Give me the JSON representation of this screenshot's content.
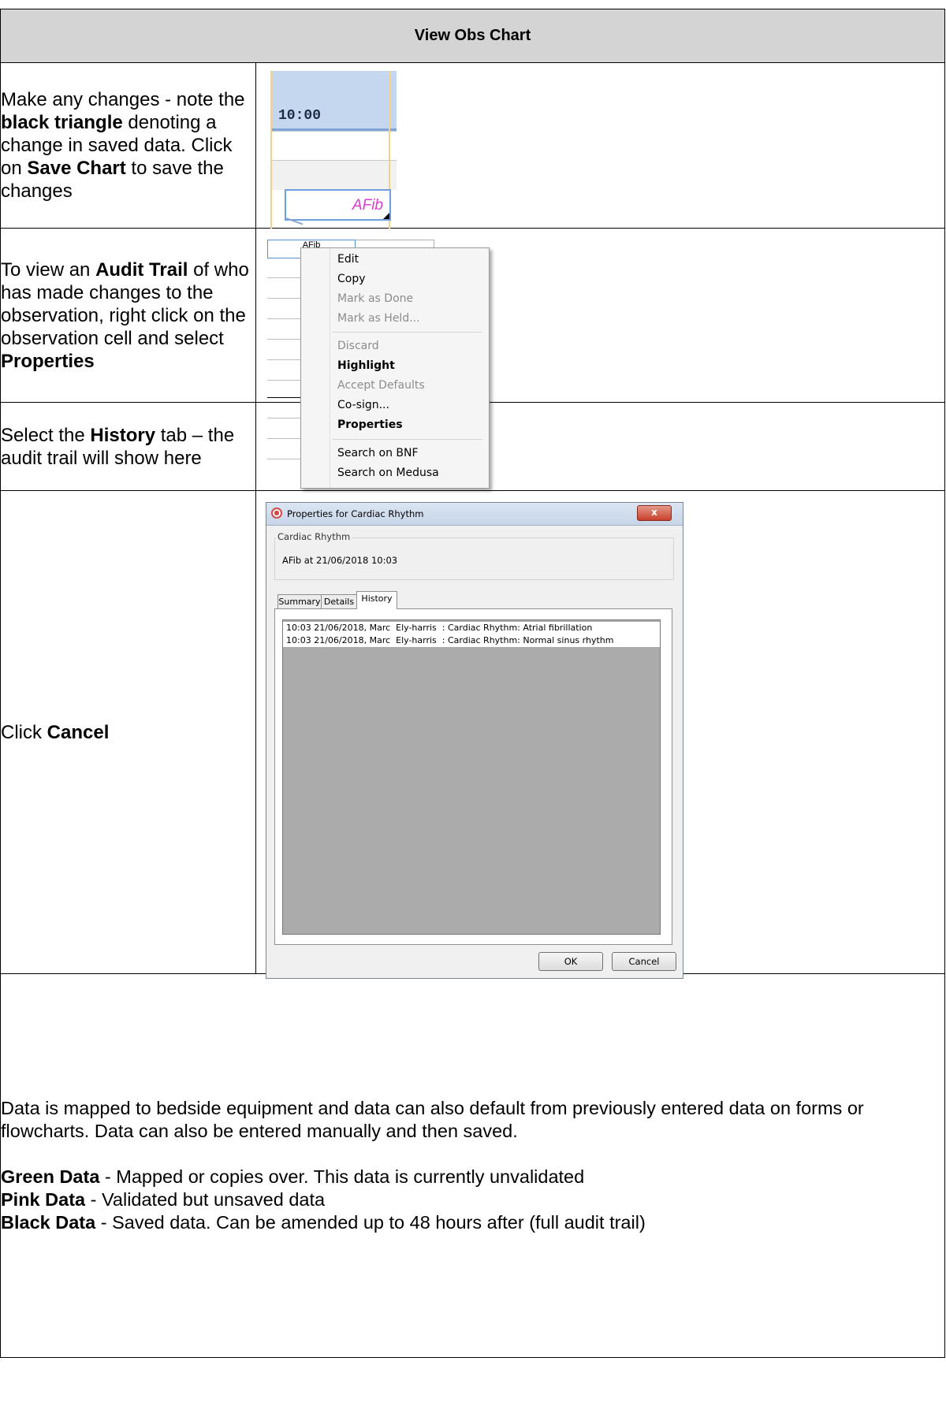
{
  "header": {
    "title": "View Obs Chart"
  },
  "rows": [
    {
      "segments": [
        {
          "t": "Make any changes - note the ",
          "b": false
        },
        {
          "t": "black triangle",
          "b": true
        },
        {
          "t": " denoting a change in saved data. Click on ",
          "b": false
        },
        {
          "t": "Save Chart",
          "b": true
        },
        {
          "t": " to save the changes",
          "b": false
        }
      ]
    },
    {
      "segments": [
        {
          "t": "To view an ",
          "b": false
        },
        {
          "t": "Audit Trail",
          "b": true
        },
        {
          "t": " of who has made changes to the observation, right click on the observation cell and select ",
          "b": false
        },
        {
          "t": "Properties",
          "b": true
        }
      ]
    },
    {
      "segments": [
        {
          "t": "Select the ",
          "b": false
        },
        {
          "t": "History",
          "b": true
        },
        {
          "t": " tab – the audit trail will show here",
          "b": false
        }
      ]
    },
    {
      "segments": [
        {
          "t": "Click ",
          "b": false
        },
        {
          "t": "Cancel",
          "b": true
        }
      ]
    }
  ],
  "obs_cell": {
    "time": "10:00",
    "value": "AFib"
  },
  "context_menu": {
    "cell_value": "AFib",
    "items": [
      {
        "label": "Edit",
        "state": "enabled",
        "bold": false
      },
      {
        "label": "Copy",
        "state": "enabled",
        "bold": false
      },
      {
        "label": "Mark as Done",
        "state": "disabled",
        "bold": false
      },
      {
        "label": "Mark as Held...",
        "state": "disabled",
        "bold": false
      },
      {
        "label": "Discard",
        "state": "disabled",
        "bold": false
      },
      {
        "label": "Highlight",
        "state": "enabled",
        "bold": true
      },
      {
        "label": "Accept Defaults",
        "state": "disabled",
        "bold": false
      },
      {
        "label": "Co-sign...",
        "state": "enabled",
        "bold": false
      },
      {
        "label": "Properties",
        "state": "enabled",
        "bold": true
      },
      {
        "label": "Search on BNF",
        "state": "enabled",
        "bold": false
      },
      {
        "label": "Search on Medusa",
        "state": "enabled",
        "bold": false
      }
    ]
  },
  "dialog": {
    "title": "Properties for Cardiac Rhythm",
    "close_label": "x",
    "group_title": "Cardiac Rhythm",
    "group_value": "AFib at 21/06/2018 10:03",
    "tabs": [
      "Summary",
      "Details",
      "History"
    ],
    "active_tab": "History",
    "history": [
      "10:03 21/06/2018, Marc  Ely-harris  : Cardiac Rhythm: Atrial fibrillation",
      "10:03 21/06/2018, Marc  Ely-harris  : Cardiac Rhythm: Normal sinus rhythm"
    ],
    "ok_label": "OK",
    "cancel_label": "Cancel"
  },
  "bottom_note": {
    "intro": "Data is mapped to bedside equipment and data can also default from previously entered data on forms or flowcharts. Data can also be entered manually and then saved.",
    "legend": [
      {
        "term": "Green Data",
        "desc": " - Mapped or copies over. This data is currently unvalidated"
      },
      {
        "term": "Pink Data",
        "desc": " - Validated but unsaved data"
      },
      {
        "term": "Black Data",
        "desc": " - Saved data. Can be amended up to 48 hours after (full audit trail)"
      }
    ]
  }
}
